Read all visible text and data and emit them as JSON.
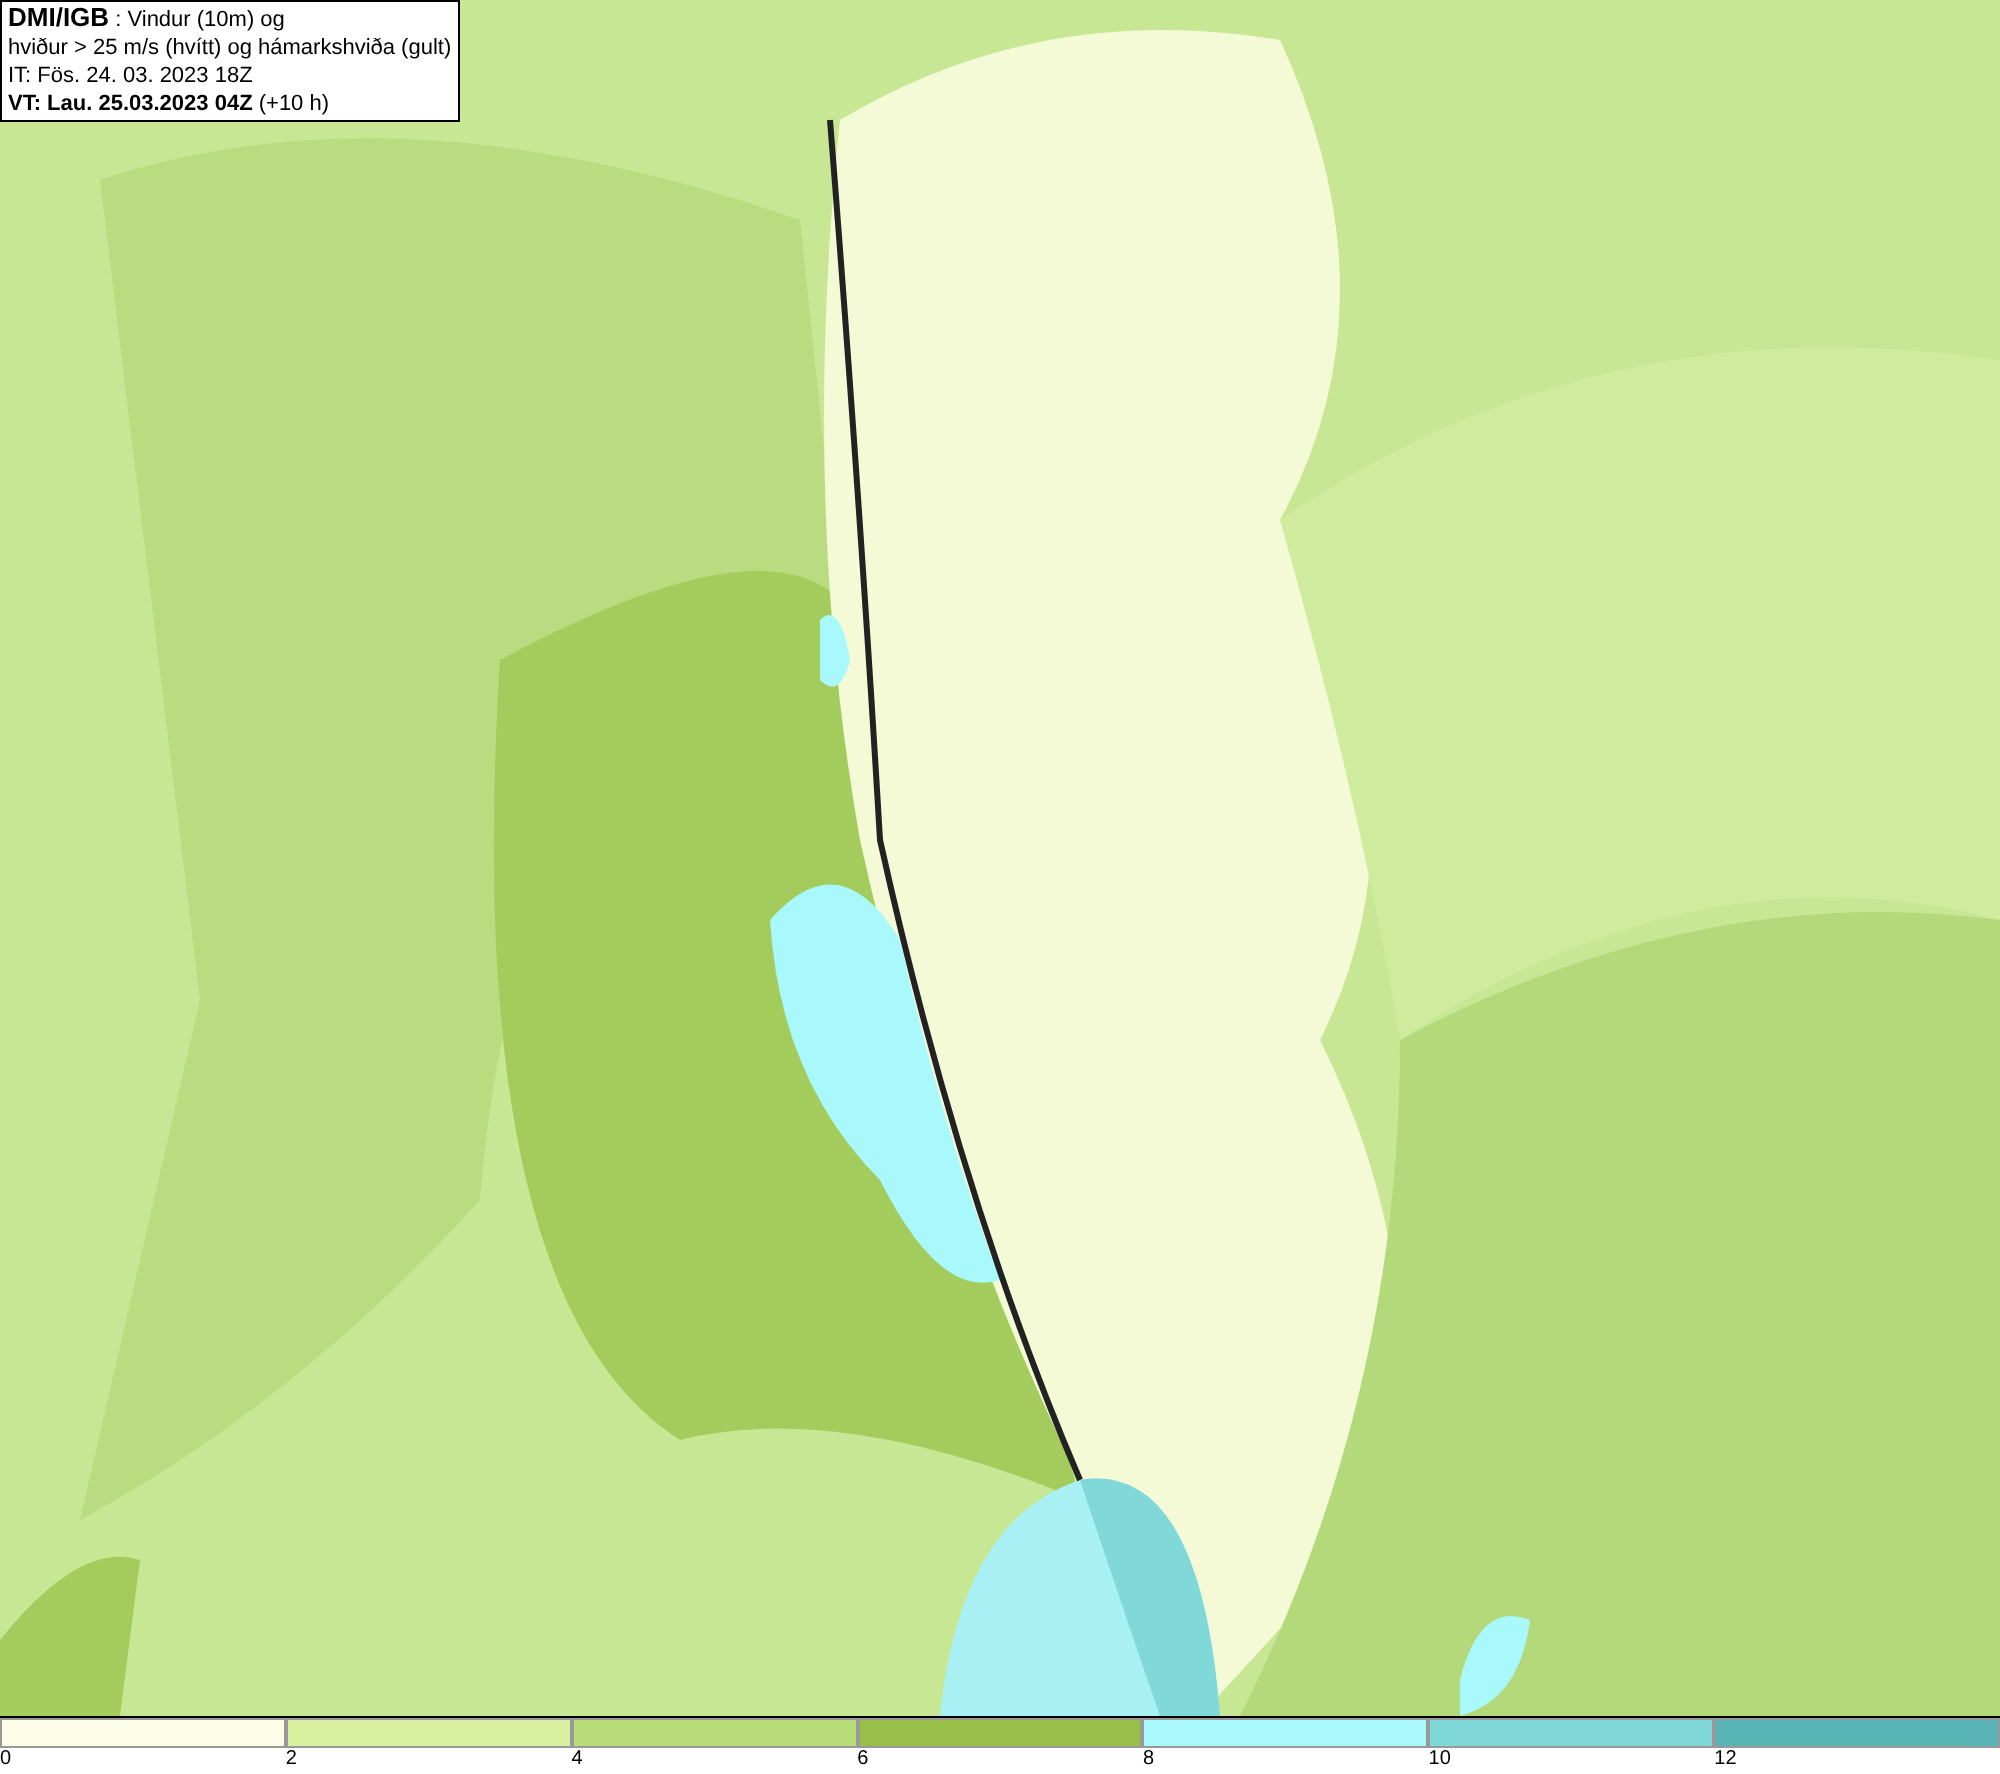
{
  "info_box": {
    "lines": [
      "**DMI/IGB** : Vindur (10m) og",
      "hviður > 25 m/s (hvítt) og hámarkshviða (gult)",
      "IT: Fös. 24. 03. 2023 18Z",
      "**VT: Lau. 25.03.2023 04Z** (+10 h)"
    ]
  },
  "legend": {
    "bins": [
      {
        "label": "0",
        "color": "#fbfde6"
      },
      {
        "label": "2",
        "color": "#d8f0a0"
      },
      {
        "label": "4",
        "color": "#b8dc78"
      },
      {
        "label": "6",
        "color": "#98c048"
      },
      {
        "label": "8",
        "color": "#a8f8fc"
      },
      {
        "label": "10",
        "color": "#80d8d8"
      },
      {
        "label": "12",
        "color": "#58b4b4"
      }
    ]
  }
}
